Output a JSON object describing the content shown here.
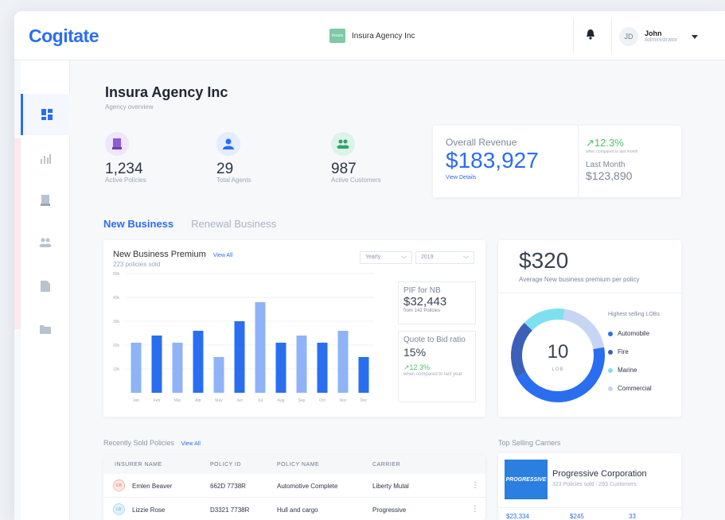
{
  "brand": {
    "name": "Cogitate"
  },
  "header": {
    "agency_logo_text": "Insura",
    "agency_name": "Insura Agency Inc",
    "user": {
      "initials": "JD",
      "name": "John",
      "role": "Administrator"
    }
  },
  "sidebar": {
    "items": [
      {
        "icon": "dashboard-icon",
        "active": true
      },
      {
        "icon": "analytics-icon",
        "active": false
      },
      {
        "icon": "policy-icon",
        "active": false
      },
      {
        "icon": "customers-icon",
        "active": false
      },
      {
        "icon": "document-icon",
        "active": false
      },
      {
        "icon": "folder-icon",
        "active": false
      }
    ]
  },
  "page": {
    "title": "Insura Agency Inc",
    "subtitle": "Agency overview"
  },
  "stats": [
    {
      "value": "1,234",
      "label": "Active Policies",
      "icon": "policy-icon",
      "color": "#8f5bd6",
      "bg": "#efe6fb"
    },
    {
      "value": "29",
      "label": "Total Agents",
      "icon": "agent-icon",
      "color": "#2a6ef0",
      "bg": "#e4edfd"
    },
    {
      "value": "987",
      "label": "Active Customers",
      "icon": "customers-icon",
      "color": "#2fa36b",
      "bg": "#ddf3e8"
    }
  ],
  "revenue": {
    "title": "Overall Revenue",
    "amount": "$183,927",
    "link": "View Details",
    "change": "↗12.3%",
    "compare_text": "when compared to last month",
    "last_month_label": "Last Month",
    "last_month_value": "$123,890"
  },
  "tabs": [
    {
      "label": "New Business",
      "active": true
    },
    {
      "label": "Renewal Business",
      "active": false
    }
  ],
  "premium": {
    "title": "New Business Premium",
    "link": "View All",
    "subtitle": "223 policies sold",
    "period": "Yearly",
    "year": "2019",
    "pif_title": "PIF for NB",
    "pif_value": "$32,443",
    "pif_sub": "from 142 Policies",
    "qtb_title": "Quote to Bid ratio",
    "qtb_value": "15%",
    "qtb_change": "↗12.3%",
    "qtb_sub": "when compared to last year"
  },
  "chart_data": {
    "type": "bar",
    "categories": [
      "Jan",
      "Feb",
      "Mar",
      "Apr",
      "May",
      "Jun",
      "Jul",
      "Aug",
      "Sep",
      "Oct",
      "Nov",
      "Dec"
    ],
    "values": [
      21,
      24,
      21,
      26,
      15,
      30,
      38,
      21,
      24,
      21,
      26,
      15
    ],
    "ylim": [
      0,
      50
    ],
    "yticks": [
      "10k",
      "20k",
      "30k",
      "40k",
      "50k"
    ],
    "colors": [
      "#8fb3f7",
      "#2a6ef0"
    ]
  },
  "lob": {
    "amount": "$320",
    "subtitle": "Average New business premium per policy",
    "center_value": "10",
    "center_label": "LOB",
    "legend_title": "Highest selling LOBs",
    "items": [
      {
        "label": "Automobile",
        "color": "#2a6ef0",
        "value": 45
      },
      {
        "label": "Fire",
        "color": "#3c5fb8",
        "value": 20
      },
      {
        "label": "Marine",
        "color": "#7ee0ee",
        "value": 15
      },
      {
        "label": "Commercial",
        "color": "#c7d5f5",
        "value": 20
      }
    ]
  },
  "recent": {
    "title": "Recently Sold Policies",
    "link": "View All",
    "columns": [
      "INSURER NAME",
      "POLICY ID",
      "POLICY NAME",
      "CARRIER"
    ],
    "rows": [
      {
        "initials": "EB",
        "name": "Emlen Beaver",
        "policy_id": "662D 7738R",
        "policy_name": "Automotive Complete",
        "carrier": "Liberty Mutal",
        "color": "#e9785f",
        "bg": "#fde9e3"
      },
      {
        "initials": "LR",
        "name": "Lizzie Rose",
        "policy_id": "D3321 7738R",
        "policy_name": "Hull and cargo",
        "carrier": "Progressive",
        "color": "#4aa8d8",
        "bg": "#e1f2fb"
      }
    ]
  },
  "carriers": {
    "title": "Top Selling Carriers",
    "logo_text": "PROGRESSIVE",
    "name": "Progressive Corporation",
    "policies": "323 Policies sold",
    "customers": "293 Customers",
    "foot": [
      "$23,334",
      "$245",
      "33"
    ]
  }
}
